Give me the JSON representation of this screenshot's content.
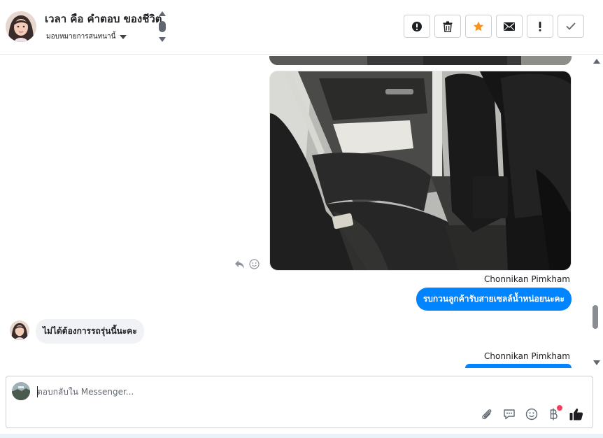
{
  "header": {
    "contact_name": "เวลา คือ คำตอบ ของชีวิต",
    "assign_label": "มอบหมายการสนทนานี้",
    "toolbar": [
      {
        "name": "report-button",
        "icon": "alert-circle-icon"
      },
      {
        "name": "delete-button",
        "icon": "trash-icon"
      },
      {
        "name": "star-button",
        "icon": "star-icon"
      },
      {
        "name": "mark-unread-button",
        "icon": "envelope-icon"
      },
      {
        "name": "mark-important-button",
        "icon": "exclamation-icon"
      },
      {
        "name": "mark-done-button",
        "icon": "check-icon"
      }
    ]
  },
  "messages": [
    {
      "type": "outgoing",
      "sender": "Chonnikan Pimkham",
      "text": "รบกวนลูกค้ารับสายเซลล์น้ำหน่อยนะคะ"
    },
    {
      "type": "incoming",
      "text": "ไม่ได้ต้องการรถรุ่นนี้นะคะ"
    },
    {
      "type": "outgoing",
      "sender": "Chonnikan Pimkham",
      "text": ""
    }
  ],
  "composer": {
    "placeholder": "ตอบกลับใน Messenger..."
  },
  "colors": {
    "accent": "#0084ff",
    "star": "#f7931e",
    "badge": "#fa3e5e"
  }
}
